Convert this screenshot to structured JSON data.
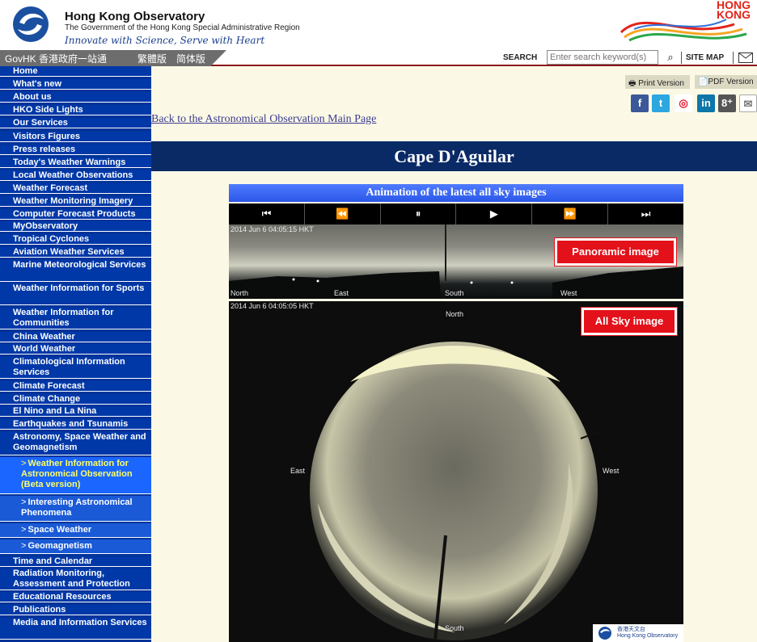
{
  "header": {
    "org_name": "Hong Kong Observatory",
    "org_subtitle": "The Government of the Hong Kong Special Administrative Region",
    "motto": "Innovate with Science, Serve with Heart",
    "brand_text": "HONG KONG"
  },
  "govbar": {
    "govhk": "GovHK 香港政府一站通",
    "traditional": "繁體版",
    "simplified": "简体版",
    "search_label": "SEARCH",
    "search_placeholder": "Enter search keyword(s)",
    "sitemap": "SITE MAP"
  },
  "sidebar": {
    "items": [
      "Home",
      "What's new",
      "About us",
      "HKO Side Lights",
      "Our Services",
      "Visitors Figures",
      "Press releases",
      "Today's Weather Warnings",
      "Local Weather Observations",
      "Weather Forecast",
      "Weather Monitoring Imagery",
      "Computer Forecast Products",
      "MyObservatory",
      "Tropical Cyclones",
      "Aviation Weather Services",
      "Marine Meteorological Services",
      "Weather Information for Sports",
      "Weather Information for Communities",
      "China Weather",
      "World Weather",
      "Climatological Information Services",
      "Climate Forecast",
      "Climate Change",
      "El Nino and La Nina",
      "Earthquakes and Tsunamis",
      "Astronomy, Space Weather and Geomagnetism"
    ],
    "sub_items": [
      "Weather Information for Astronomical Observation (Beta version)",
      "Interesting Astronomical Phenomena",
      "Space Weather",
      "Geomagnetism"
    ],
    "items_after": [
      "Time and Calendar",
      "Radiation Monitoring, Assessment and Protection",
      "Educational Resources",
      "Publications",
      "Media and Information Services"
    ]
  },
  "main": {
    "print": "Print Version",
    "pdf": "PDF Version",
    "back_link": "Back to the Astronomical Observation Main Page",
    "title": "Cape D'Aguilar",
    "animation_title": "Animation of the latest all sky images",
    "controls": [
      "⏮",
      "⏪",
      "⏸",
      "▶",
      "⏩",
      "⏭"
    ],
    "pano_timestamp": "2014 Jun 6  04:05:15 HKT",
    "pano_dirs": [
      "North",
      "East",
      "South",
      "West"
    ],
    "sky_timestamp": "2014 Jun 6  04:05:05 HKT",
    "sky_dirs": {
      "north": "North",
      "east": "East",
      "west": "West",
      "south": "South"
    },
    "watermark_cn": "香港天文台",
    "watermark_en": "Hong Kong Observatory",
    "callout_pano": "Panoramic image",
    "callout_sky": "All Sky image"
  },
  "social_icons": [
    "facebook-icon",
    "twitter-icon",
    "weibo-icon",
    "linkedin-icon",
    "googleplus-icon",
    "email-icon"
  ],
  "colors": {
    "sidebar": "#0038a8",
    "title_bar": "#0a2a66",
    "callout": "#e3111a",
    "page_bg": "#fbf9e6"
  }
}
